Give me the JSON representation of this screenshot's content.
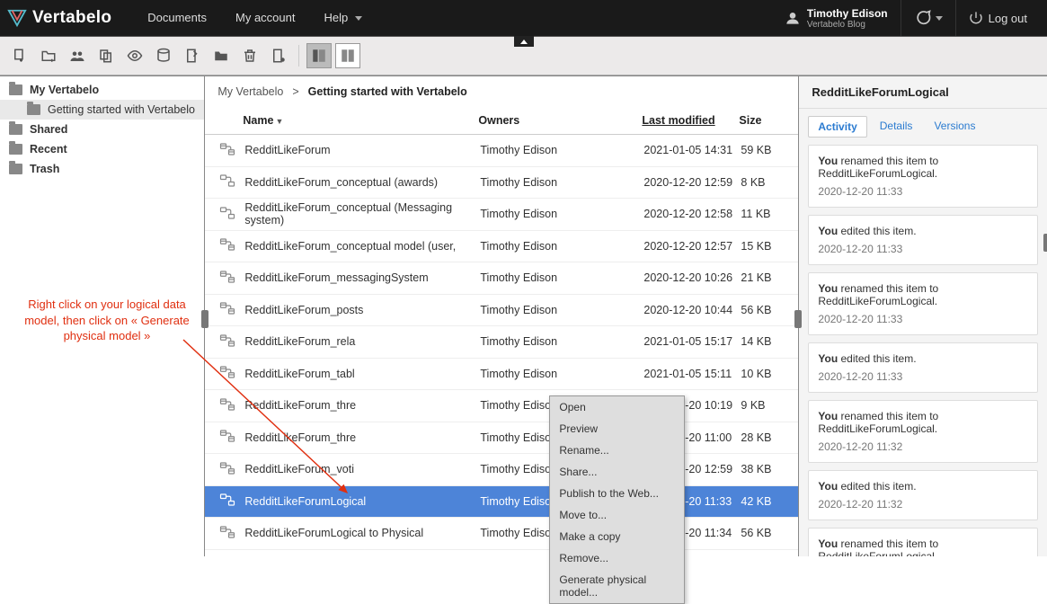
{
  "brand": "Vertabelo",
  "nav": {
    "documents": "Documents",
    "my_account": "My account",
    "help": "Help",
    "logout": "Log out"
  },
  "user": {
    "name": "Timothy Edison",
    "sub": "Vertabelo Blog"
  },
  "sidebar": {
    "items": [
      {
        "label": "My Vertabelo",
        "bold": true
      },
      {
        "label": "Getting started with Vertabelo",
        "child": true
      },
      {
        "label": "Shared",
        "bold": true
      },
      {
        "label": "Recent",
        "bold": true
      },
      {
        "label": "Trash",
        "bold": true
      }
    ]
  },
  "breadcrumb": {
    "root": "My Vertabelo",
    "sep": ">",
    "current": "Getting started with Vertabelo"
  },
  "table": {
    "headers": {
      "name": "Name",
      "owner": "Owners",
      "modified": "Last modified",
      "size": "Size"
    },
    "rows": [
      {
        "icon": "phys",
        "name": "RedditLikeForum",
        "owner": "Timothy Edison",
        "modified": "2021-01-05 14:31",
        "size": "59 KB"
      },
      {
        "icon": "log",
        "name": "RedditLikeForum_conceptual (awards)",
        "owner": "Timothy Edison",
        "modified": "2020-12-20 12:59",
        "size": "8 KB"
      },
      {
        "icon": "log",
        "name": "RedditLikeForum_conceptual (Messaging system)",
        "owner": "Timothy Edison",
        "modified": "2020-12-20 12:58",
        "size": "11 KB"
      },
      {
        "icon": "phys",
        "name": "RedditLikeForum_conceptual model (user,",
        "owner": "Timothy Edison",
        "modified": "2020-12-20 12:57",
        "size": "15 KB"
      },
      {
        "icon": "phys",
        "name": "RedditLikeForum_messagingSystem",
        "owner": "Timothy Edison",
        "modified": "2020-12-20 10:26",
        "size": "21 KB"
      },
      {
        "icon": "phys",
        "name": "RedditLikeForum_posts",
        "owner": "Timothy Edison",
        "modified": "2020-12-20 10:44",
        "size": "56 KB"
      },
      {
        "icon": "phys",
        "name": "RedditLikeForum_rela",
        "owner": "Timothy Edison",
        "modified": "2021-01-05 15:17",
        "size": "14 KB"
      },
      {
        "icon": "phys",
        "name": "RedditLikeForum_tabl",
        "owner": "Timothy Edison",
        "modified": "2021-01-05 15:11",
        "size": "10 KB"
      },
      {
        "icon": "phys",
        "name": "RedditLikeForum_thre",
        "owner": "Timothy Edison",
        "modified": "2020-12-20 10:19",
        "size": "9 KB"
      },
      {
        "icon": "phys",
        "name": "RedditLikeForum_thre",
        "owner": "Timothy Edison",
        "modified": "2020-12-20 11:00",
        "size": "28 KB"
      },
      {
        "icon": "phys",
        "name": "RedditLikeForum_voti",
        "owner": "Timothy Edison",
        "modified": "2020-12-20 12:59",
        "size": "38 KB"
      },
      {
        "icon": "log",
        "name": "RedditLikeForumLogical",
        "owner": "Timothy Edison",
        "modified": "2020-12-20 11:33",
        "size": "42 KB",
        "selected": true
      },
      {
        "icon": "phys",
        "name": "RedditLikeForumLogical to Physical",
        "owner": "Timothy Edison",
        "modified": "2020-12-20 11:34",
        "size": "56 KB"
      }
    ]
  },
  "context_menu": {
    "items": [
      "Open",
      "Preview",
      "Rename...",
      "Share...",
      "Publish to the Web...",
      "Move to...",
      "Make a copy",
      "Remove...",
      "Generate physical model..."
    ]
  },
  "right_panel": {
    "title": "RedditLikeForumLogical",
    "tabs": [
      "Activity",
      "Details",
      "Versions"
    ],
    "activity": [
      {
        "html": "<b>You</b> renamed this item to RedditLikeForumLogical.",
        "time": "2020-12-20 11:33"
      },
      {
        "html": "<b>You</b> edited this item.",
        "time": "2020-12-20 11:33"
      },
      {
        "html": "<b>You</b> renamed this item to RedditLikeForumLogical.",
        "time": "2020-12-20 11:33"
      },
      {
        "html": "<b>You</b> edited this item.",
        "time": "2020-12-20 11:33"
      },
      {
        "html": "<b>You</b> renamed this item to RedditLikeForumLogical.",
        "time": "2020-12-20 11:32"
      },
      {
        "html": "<b>You</b> edited this item.",
        "time": "2020-12-20 11:32"
      },
      {
        "html": "<b>You</b> renamed this item to RedditLikeForumLogical.",
        "time": ""
      }
    ]
  },
  "annotation": "Right click on your logical data model, then click on « Generate physical model »"
}
